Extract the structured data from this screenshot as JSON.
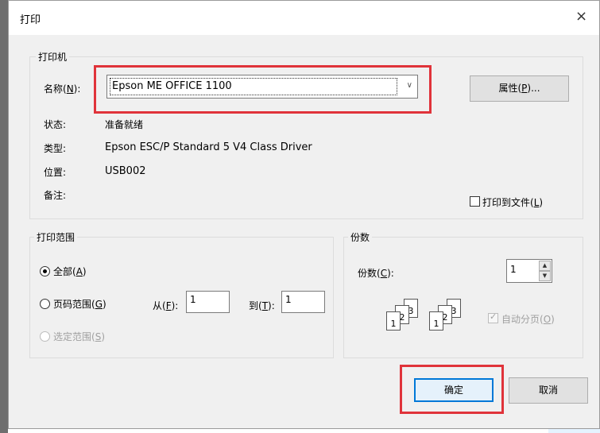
{
  "window": {
    "title": "打印",
    "close_glyph": "×"
  },
  "printer_group": {
    "legend": "打印机",
    "name_label_prefix": "名称(",
    "name_label_key": "N",
    "name_label_suffix": "):",
    "name_value": "Epson ME OFFICE 1100",
    "properties_prefix": "属性(",
    "properties_key": "P",
    "properties_suffix": ")...",
    "status_label": "状态:",
    "status_value": "准备就绪",
    "type_label": "类型:",
    "type_value": "Epson ESC/P Standard 5 V4 Class Driver",
    "location_label": "位置:",
    "location_value": "USB002",
    "comment_label": "备注:",
    "print_to_file_prefix": "打印到文件(",
    "print_to_file_key": "L",
    "print_to_file_suffix": ")",
    "print_to_file_checked": false
  },
  "range_group": {
    "legend": "打印范围",
    "all_prefix": "全部(",
    "all_key": "A",
    "all_suffix": ")",
    "pages_prefix": "页码范围(",
    "pages_key": "G",
    "pages_suffix": ")",
    "from_prefix": "从(",
    "from_key": "F",
    "from_suffix": "):",
    "from_value": "1",
    "to_prefix": "到(",
    "to_key": "T",
    "to_suffix": "):",
    "to_value": "1",
    "selection_prefix": "选定范围(",
    "selection_key": "S",
    "selection_suffix": ")",
    "selected": "all"
  },
  "copies_group": {
    "legend": "份数",
    "copies_prefix": "份数(",
    "copies_key": "C",
    "copies_suffix": "):",
    "copies_value": "1",
    "collate_label": "自动分页(",
    "collate_key": "O",
    "collate_suffix": ")",
    "collate_checked": true,
    "collate_pages": [
      "1",
      "2",
      "3"
    ]
  },
  "buttons": {
    "ok": "确定",
    "cancel": "取消"
  },
  "colors": {
    "highlight": "#e0333a",
    "accent": "#0078d7"
  }
}
